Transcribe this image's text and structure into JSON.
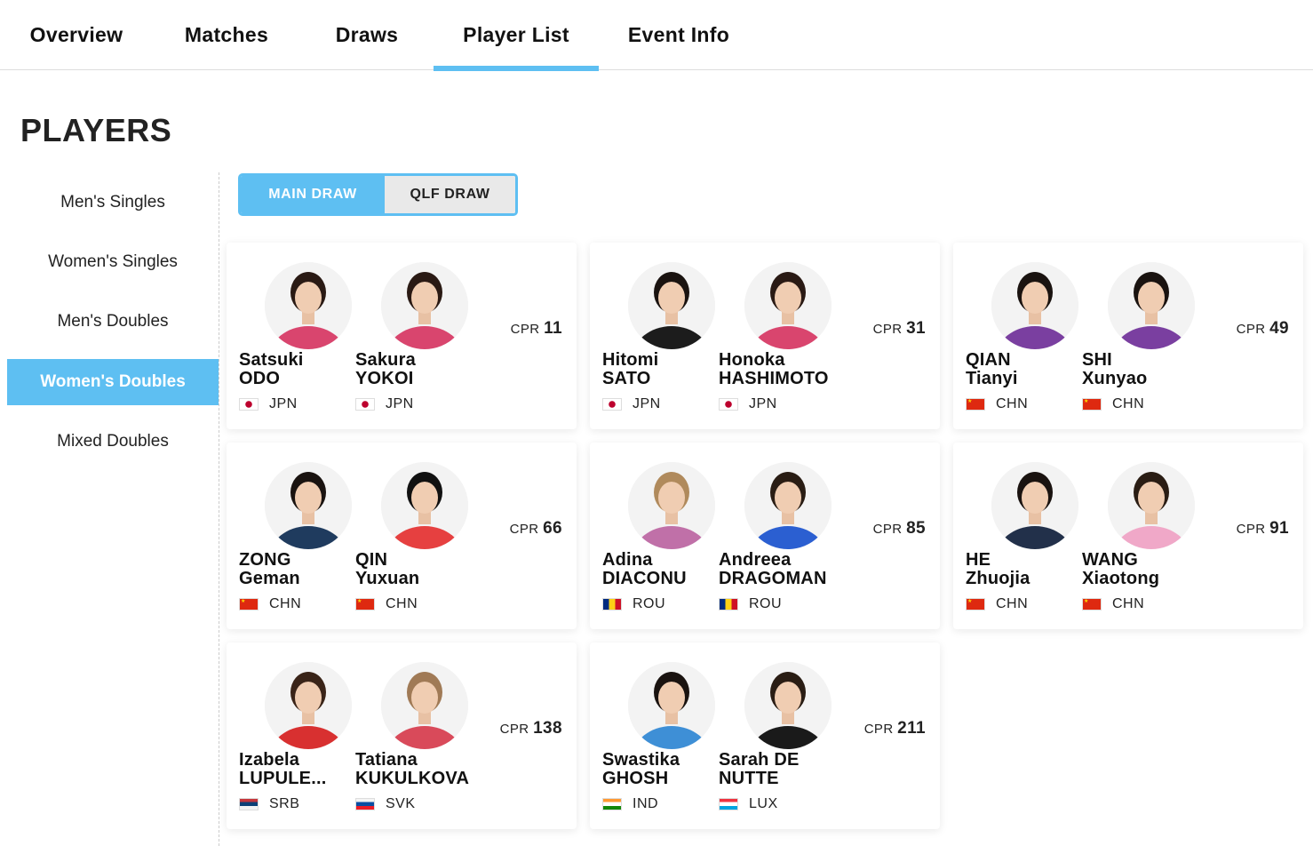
{
  "tabs": [
    {
      "label": "Overview"
    },
    {
      "label": "Matches"
    },
    {
      "label": "Draws"
    },
    {
      "label": "Player List"
    },
    {
      "label": "Event Info"
    }
  ],
  "active_tab": "Player List",
  "page_title": "PLAYERS",
  "sidebar": {
    "items": [
      {
        "label": "Men's Singles"
      },
      {
        "label": "Women's Singles"
      },
      {
        "label": "Men's Doubles"
      },
      {
        "label": "Women's Doubles"
      },
      {
        "label": "Mixed Doubles"
      }
    ],
    "active": "Women's Doubles"
  },
  "draw_toggle": {
    "main_label": "MAIN DRAW",
    "qlf_label": "QLF DRAW",
    "active": "MAIN DRAW"
  },
  "cpr_label": "CPR",
  "colors": {
    "accent": "#5ebff2",
    "shirt_jpn": "#d9456e",
    "shirt_chn_purple": "#7a3fa0",
    "shirt_chn_navy": "#22304a"
  },
  "pairs": [
    {
      "cpr": "11",
      "players": [
        {
          "first": "Satsuki",
          "last": "ODO",
          "country": "JPN"
        },
        {
          "first": "Sakura",
          "last": "YOKOI",
          "country": "JPN"
        }
      ]
    },
    {
      "cpr": "31",
      "players": [
        {
          "first": "Hitomi",
          "last": "SATO",
          "country": "JPN"
        },
        {
          "first": "Honoka",
          "last": "HASHIMOTO",
          "country": "JPN"
        }
      ]
    },
    {
      "cpr": "49",
      "players": [
        {
          "first": "QIAN",
          "last": "Tianyi",
          "country": "CHN"
        },
        {
          "first": "SHI",
          "last": "Xunyao",
          "country": "CHN"
        }
      ]
    },
    {
      "cpr": "66",
      "players": [
        {
          "first": "ZONG",
          "last": "Geman",
          "country": "CHN"
        },
        {
          "first": "QIN",
          "last": "Yuxuan",
          "country": "CHN"
        }
      ]
    },
    {
      "cpr": "85",
      "players": [
        {
          "first": "Adina",
          "last": "DIACONU",
          "country": "ROU"
        },
        {
          "first": "Andreea",
          "last": "DRAGOMAN",
          "country": "ROU"
        }
      ]
    },
    {
      "cpr": "91",
      "players": [
        {
          "first": "HE",
          "last": "Zhuojia",
          "country": "CHN"
        },
        {
          "first": "WANG",
          "last": "Xiaotong",
          "country": "CHN"
        }
      ]
    },
    {
      "cpr": "138",
      "players": [
        {
          "first": "Izabela",
          "last": "LUPULE...",
          "country": "SRB"
        },
        {
          "first": "Tatiana",
          "last": "KUKULKOVA",
          "country": "SVK"
        }
      ]
    },
    {
      "cpr": "211",
      "players": [
        {
          "first": "Swastika",
          "last": "GHOSH",
          "country": "IND"
        },
        {
          "first": "Sarah DE",
          "last": "NUTTE",
          "country": "LUX"
        }
      ]
    }
  ]
}
